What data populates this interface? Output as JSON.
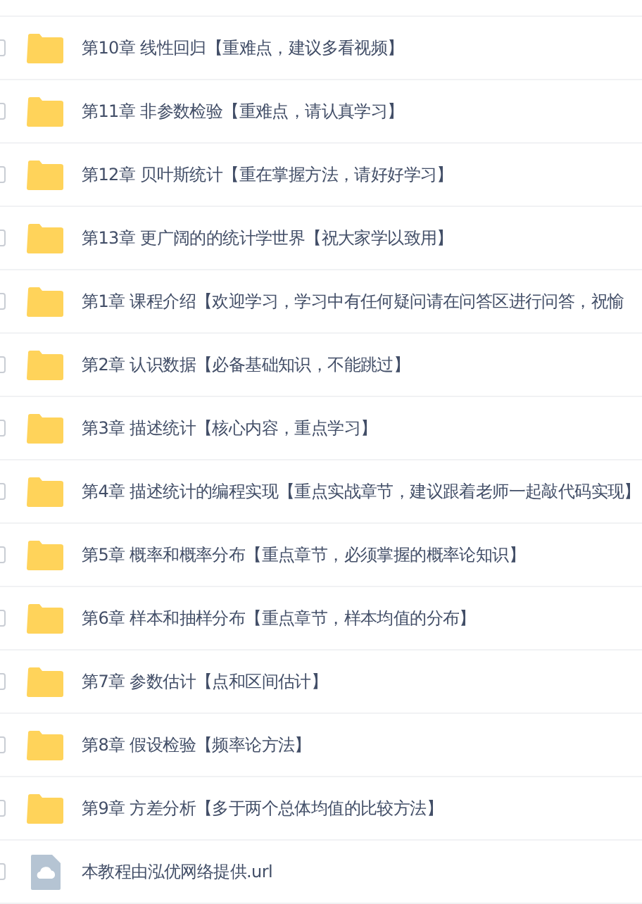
{
  "files": [
    {
      "kind": "folder",
      "name": "第10章 线性回归【重难点，建议多看视频】",
      "checked": false
    },
    {
      "kind": "folder",
      "name": "第11章 非参数检验【重难点，请认真学习】",
      "checked": false
    },
    {
      "kind": "folder",
      "name": "第12章 贝叶斯统计【重在掌握方法，请好好学习】",
      "checked": false
    },
    {
      "kind": "folder",
      "name": "第13章 更广阔的的统计学世界【祝大家学以致用】",
      "checked": false
    },
    {
      "kind": "folder",
      "name": "第1章 课程介绍【欢迎学习，学习中有任何疑问请在问答区进行问答，祝愉",
      "checked": false
    },
    {
      "kind": "folder",
      "name": "第2章 认识数据【必备基础知识，不能跳过】",
      "checked": false
    },
    {
      "kind": "folder",
      "name": "第3章 描述统计【核心内容，重点学习】",
      "checked": false
    },
    {
      "kind": "folder",
      "name": "第4章 描述统计的编程实现【重点实战章节，建议跟着老师一起敲代码实现】",
      "checked": false
    },
    {
      "kind": "folder",
      "name": "第5章 概率和概率分布【重点章节，必须掌握的概率论知识】",
      "checked": false
    },
    {
      "kind": "folder",
      "name": "第6章 样本和抽样分布【重点章节，样本均值的分布】",
      "checked": false
    },
    {
      "kind": "folder",
      "name": "第7章 参数估计【点和区间估计】",
      "checked": false
    },
    {
      "kind": "folder",
      "name": "第8章 假设检验【频率论方法】",
      "checked": false
    },
    {
      "kind": "folder",
      "name": "第9章 方差分析【多于两个总体均值的比较方法】",
      "checked": false
    },
    {
      "kind": "file",
      "name": "本教程由泓优网络提供.url",
      "checked": false
    }
  ]
}
